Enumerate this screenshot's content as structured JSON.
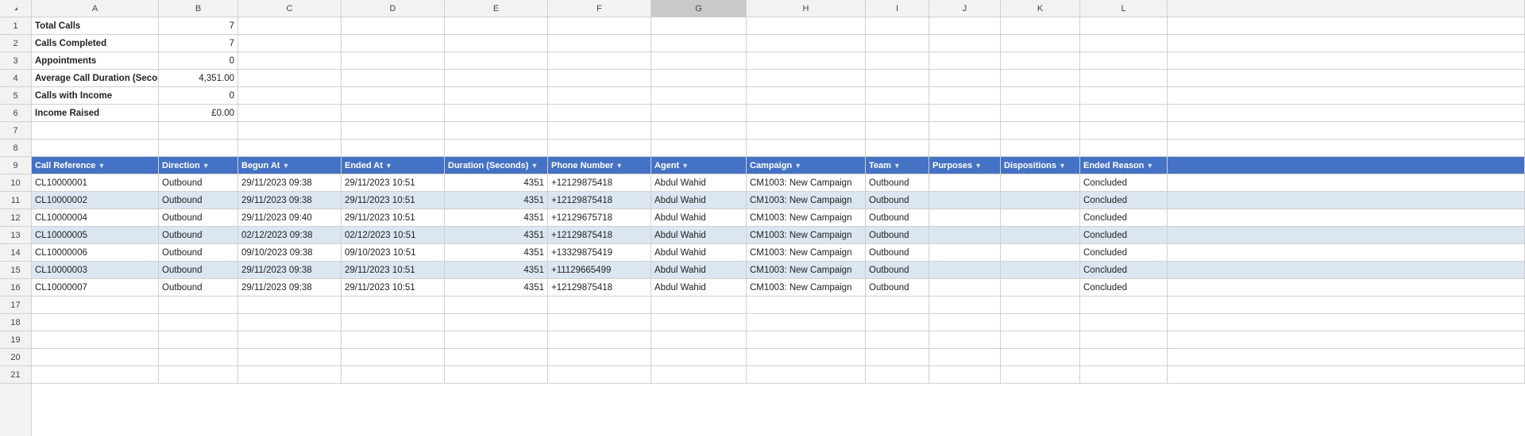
{
  "cols": [
    "A",
    "B",
    "C",
    "D",
    "E",
    "F",
    "G",
    "H",
    "I",
    "J",
    "K",
    "L"
  ],
  "selectedCol": "G",
  "summary": {
    "rows": [
      {
        "row": 1,
        "label": "Total Calls",
        "value": "7",
        "col": "B"
      },
      {
        "row": 2,
        "label": "Calls Completed",
        "value": "7",
        "col": "B"
      },
      {
        "row": 3,
        "label": "Appointments",
        "value": "0",
        "col": "B"
      },
      {
        "row": 4,
        "label": "Average Call Duration (Seconds)",
        "value": "4,351.00",
        "col": "B"
      },
      {
        "row": 5,
        "label": "Calls with Income",
        "value": "0",
        "col": "B"
      },
      {
        "row": 6,
        "label": "Income Raised",
        "value": "£0.00",
        "col": "B"
      }
    ]
  },
  "tableHeader": {
    "row": 9,
    "columns": [
      {
        "key": "call_reference",
        "label": "Call Reference"
      },
      {
        "key": "direction",
        "label": "Direction"
      },
      {
        "key": "begun_at",
        "label": "Begun At"
      },
      {
        "key": "ended_at",
        "label": "Ended At"
      },
      {
        "key": "duration",
        "label": "Duration (Seconds)"
      },
      {
        "key": "phone_number",
        "label": "Phone Number"
      },
      {
        "key": "agent",
        "label": "Agent"
      },
      {
        "key": "campaign",
        "label": "Campaign"
      },
      {
        "key": "team",
        "label": "Team"
      },
      {
        "key": "purposes",
        "label": "Purposes"
      },
      {
        "key": "dispositions",
        "label": "Dispositions"
      },
      {
        "key": "ended_reason",
        "label": "Ended Reason"
      }
    ]
  },
  "tableData": [
    {
      "row": 10,
      "call_ref": "CL10000001",
      "direction": "Outbound",
      "begun": "29/11/2023 09:38",
      "ended": "29/11/2023 10:51",
      "duration": "4351",
      "phone": "+12129875418",
      "agent": "Abdul Wahid",
      "campaign": "CM1003: New Campaign",
      "team": "Outbound",
      "purposes": "",
      "dispositions": "",
      "ended_reason": "Concluded"
    },
    {
      "row": 11,
      "call_ref": "CL10000002",
      "direction": "Outbound",
      "begun": "29/11/2023 09:38",
      "ended": "29/11/2023 10:51",
      "duration": "4351",
      "phone": "+12129875418",
      "agent": "Abdul Wahid",
      "campaign": "CM1003: New Campaign",
      "team": "Outbound",
      "purposes": "",
      "dispositions": "",
      "ended_reason": "Concluded"
    },
    {
      "row": 12,
      "call_ref": "CL10000004",
      "direction": "Outbound",
      "begun": "29/11/2023 09:40",
      "ended": "29/11/2023 10:51",
      "duration": "4351",
      "phone": "+12129675718",
      "agent": "Abdul Wahid",
      "campaign": "CM1003: New Campaign",
      "team": "Outbound",
      "purposes": "",
      "dispositions": "",
      "ended_reason": "Concluded"
    },
    {
      "row": 13,
      "call_ref": "CL10000005",
      "direction": "Outbound",
      "begun": "02/12/2023 09:38",
      "ended": "02/12/2023 10:51",
      "duration": "4351",
      "phone": "+12129875418",
      "agent": "Abdul Wahid",
      "campaign": "CM1003: New Campaign",
      "team": "Outbound",
      "purposes": "",
      "dispositions": "",
      "ended_reason": "Concluded"
    },
    {
      "row": 14,
      "call_ref": "CL10000006",
      "direction": "Outbound",
      "begun": "09/10/2023 09:38",
      "ended": "09/10/2023 10:51",
      "duration": "4351",
      "phone": "+13329875419",
      "agent": "Abdul Wahid",
      "campaign": "CM1003: New Campaign",
      "team": "Outbound",
      "purposes": "",
      "dispositions": "",
      "ended_reason": "Concluded"
    },
    {
      "row": 15,
      "call_ref": "CL10000003",
      "direction": "Outbound",
      "begun": "29/11/2023 09:38",
      "ended": "29/11/2023 10:51",
      "duration": "4351",
      "phone": "+11129665499",
      "agent": "Abdul Wahid",
      "campaign": "CM1003: New Campaign",
      "team": "Outbound",
      "purposes": "",
      "dispositions": "",
      "ended_reason": "Concluded"
    },
    {
      "row": 16,
      "call_ref": "CL10000007",
      "direction": "Outbound",
      "begun": "29/11/2023 09:38",
      "ended": "29/11/2023 10:51",
      "duration": "4351",
      "phone": "+12129875418",
      "agent": "Abdul Wahid",
      "campaign": "CM1003: New Campaign",
      "team": "Outbound",
      "purposes": "",
      "dispositions": "",
      "ended_reason": "Concluded"
    }
  ],
  "emptyRows": [
    7,
    8,
    17,
    18,
    19,
    20,
    21
  ]
}
